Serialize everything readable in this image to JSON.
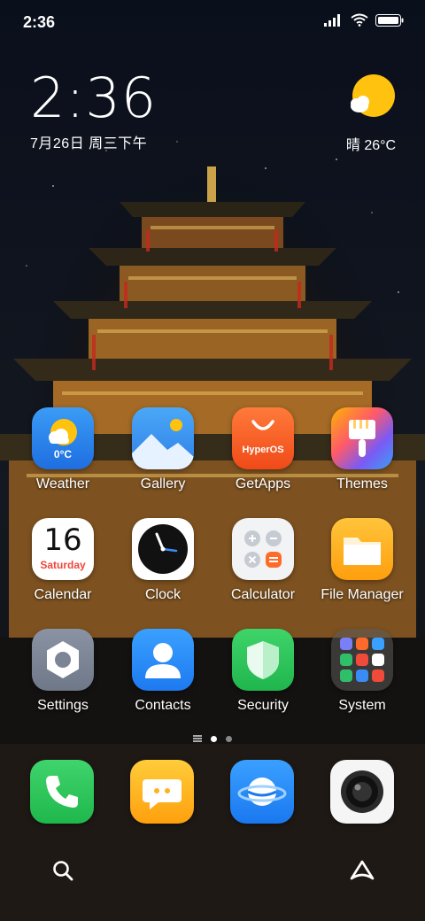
{
  "status_bar": {
    "time": "2:36"
  },
  "clock_widget": {
    "time": "2:36",
    "date": "7月26日 周三下午"
  },
  "weather_widget": {
    "condition": "晴",
    "temp": "26°C",
    "text": "晴 26°C"
  },
  "apps": {
    "weather": {
      "label": "Weather",
      "temp": "0°C"
    },
    "gallery": {
      "label": "Gallery"
    },
    "getapps": {
      "label": "GetApps",
      "brand": "HyperOS"
    },
    "themes": {
      "label": "Themes"
    },
    "calendar": {
      "label": "Calendar",
      "day": "16",
      "weekday": "Saturday"
    },
    "clock": {
      "label": "Clock"
    },
    "calculator": {
      "label": "Calculator"
    },
    "file_manager": {
      "label": "File Manager"
    },
    "settings": {
      "label": "Settings"
    },
    "contacts": {
      "label": "Contacts"
    },
    "security": {
      "label": "Security"
    },
    "system": {
      "label": "System"
    }
  },
  "pager": {
    "pages": 2,
    "active": 1
  },
  "dock": [
    "phone-app",
    "messaging-app",
    "browser-app",
    "camera-app"
  ],
  "bottom": {
    "left": "search-icon",
    "right": "assistant-icon"
  },
  "colors": {
    "accent": "#3a8cf5",
    "sun": "#ffc20e"
  }
}
